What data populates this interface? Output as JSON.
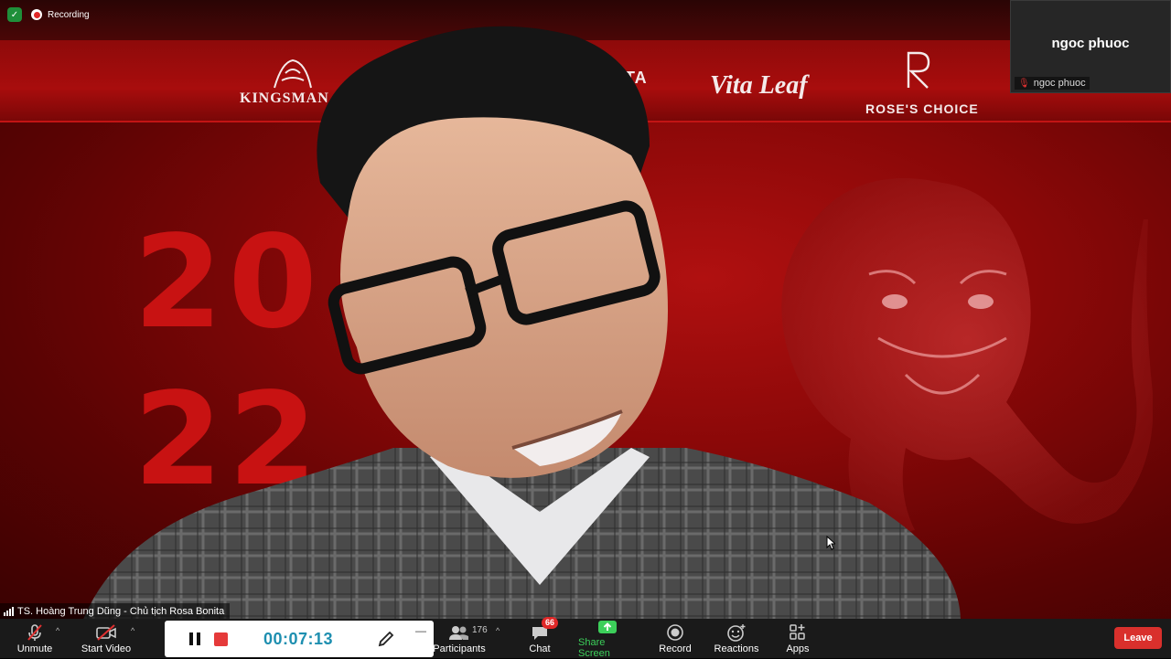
{
  "recording": {
    "label": "Recording"
  },
  "banner": {
    "logos": [
      "KINGSMAN",
      "ANISTA",
      "Vita Leaf",
      "ROSE'S CHOICE"
    ],
    "year_line1": "20",
    "year_line2": "22"
  },
  "thumbnail": {
    "display_name": "ngoc phuoc",
    "label": "ngoc phuoc"
  },
  "speaker": {
    "label": "TS. Hoàng Trung Dũng - Chủ tịch Rosa Bonita"
  },
  "toolbar": {
    "unmute": "Unmute",
    "start_video": "Start Video",
    "participants": "Participants",
    "participants_count": "176",
    "chat": "Chat",
    "chat_badge": "66",
    "share_screen": "Share Screen",
    "record": "Record",
    "reactions": "Reactions",
    "apps": "Apps",
    "leave": "Leave"
  },
  "recording_panel": {
    "timer": "00:07:13"
  },
  "colors": {
    "share_green": "#3ccf5a",
    "leave_red": "#d9302c",
    "timer_blue": "#1e8fb0"
  }
}
